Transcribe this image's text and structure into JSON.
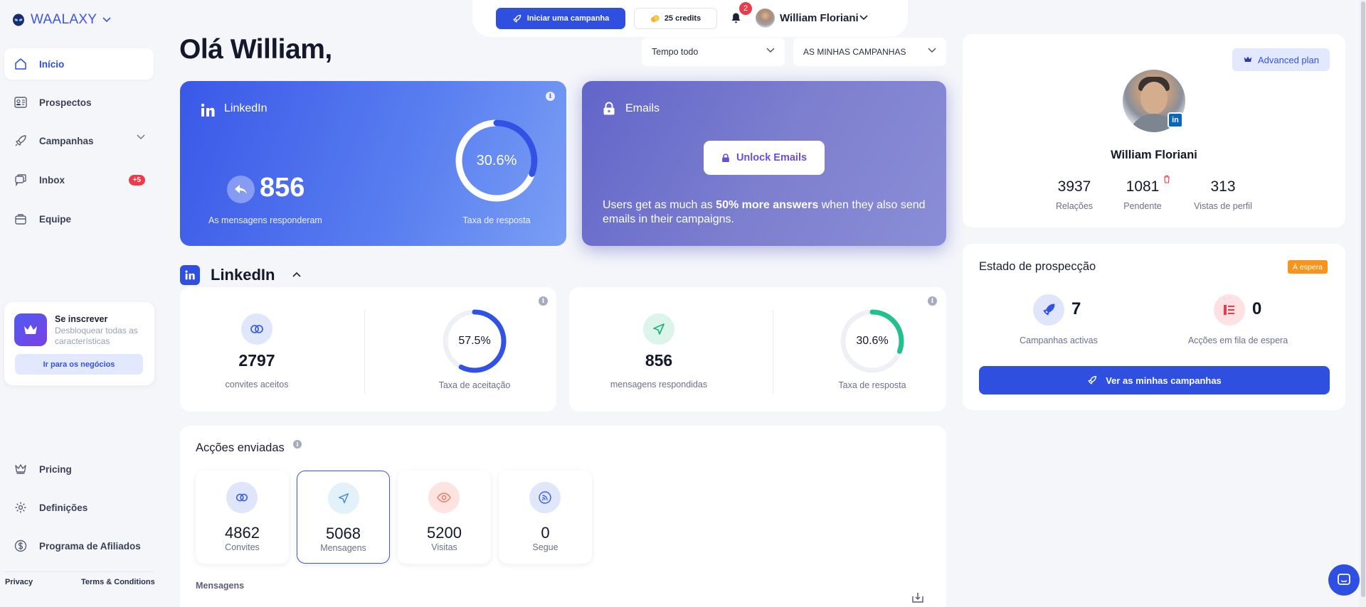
{
  "brand": {
    "name": "WAALAXY",
    "accent": "#3b56e6"
  },
  "sidebar": {
    "items": [
      {
        "label": "Início",
        "icon": "home-icon",
        "active": true
      },
      {
        "label": "Prospectos",
        "icon": "contacts-icon"
      },
      {
        "label": "Campanhas",
        "icon": "rocket-icon"
      },
      {
        "label": "Inbox",
        "icon": "chat-icon",
        "badge": "+5"
      },
      {
        "label": "Equipe",
        "icon": "briefcase-icon"
      }
    ],
    "subscribe": {
      "title": "Se inscrever",
      "desc": "Desbloquear todas as características",
      "button": "Ir para os negócios"
    },
    "bottom_items": [
      {
        "label": "Pricing",
        "icon": "crown-icon"
      },
      {
        "label": "Definições",
        "icon": "gear-icon"
      },
      {
        "label": "Programa de Afiliados",
        "icon": "dollar-icon"
      }
    ],
    "footer": {
      "privacy": "Privacy",
      "terms": "Terms & Conditions"
    }
  },
  "topbar": {
    "campaign_button": "Iniciar uma campanha",
    "credits": "25 credits",
    "notifications": "2",
    "user_name": "William Floriani"
  },
  "main": {
    "greeting": "Olá William,",
    "time_filter": "Tempo todo",
    "campaign_filter": "AS MINHAS CAMPANHAS",
    "linkedin_card": {
      "title": "LinkedIn",
      "replied_value": "856",
      "replied_label": "As mensagens responderam",
      "rate_value": "30.6%",
      "rate_fraction": 0.306,
      "rate_label": "Taxa de resposta"
    },
    "emails_card": {
      "title": "Emails",
      "unlock_button": "Unlock Emails",
      "msg_prefix": "Users get as much as ",
      "msg_bold": "50% more answers",
      "msg_suffix": " when they also send emails in their campaigns."
    },
    "linkedin_section": {
      "title": "LinkedIn",
      "invites_value": "2797",
      "invites_label": "convites aceitos",
      "accept_rate_value": "57.5%",
      "accept_rate_fraction": 0.575,
      "accept_rate_label": "Taxa de aceitação",
      "messages_value": "856",
      "messages_label": "mensagens respondidas",
      "reply_rate_value": "30.6%",
      "reply_rate_fraction": 0.306,
      "reply_rate_label": "Taxa de resposta"
    },
    "actions": {
      "title": "Acções enviadas",
      "items": [
        {
          "value": "4862",
          "label": "Convites",
          "icon": "link-icon"
        },
        {
          "value": "5068",
          "label": "Mensagens",
          "icon": "send-icon",
          "selected": true
        },
        {
          "value": "5200",
          "label": "Visitas",
          "icon": "eye-icon"
        },
        {
          "value": "0",
          "label": "Segue",
          "icon": "rss-icon"
        }
      ],
      "subtitle": "Mensagens"
    }
  },
  "profile": {
    "plan": "Advanced plan",
    "name": "William Floriani",
    "relations_value": "3937",
    "relations_label": "Relações",
    "pending_value": "1081",
    "pending_label": "Pendente",
    "views_value": "313",
    "views_label": "Vistas de perfil"
  },
  "prospecting": {
    "title": "Estado de prospecção",
    "status": "À espera",
    "active_value": "7",
    "active_label": "Campanhas activas",
    "queue_value": "0",
    "queue_label": "Acções em fila de espera",
    "button": "Ver as minhas campanhas"
  },
  "colors": {
    "primary": "#2e4fe0",
    "danger": "#ec3b4a",
    "warning": "#f7941d",
    "green": "#22c08a"
  }
}
